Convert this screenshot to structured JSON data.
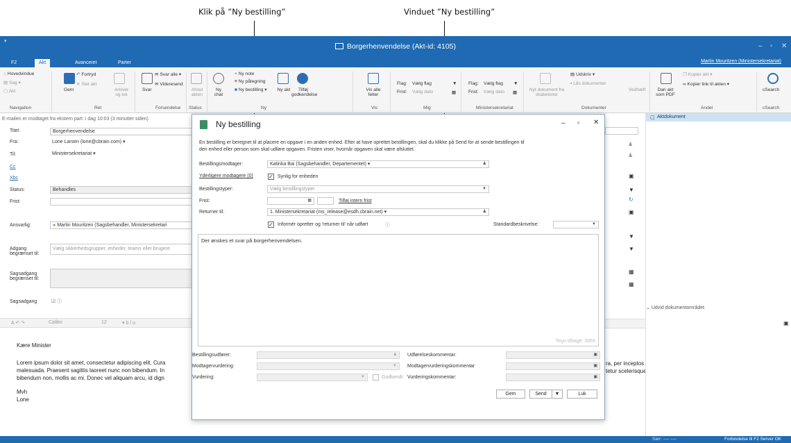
{
  "callouts": {
    "left": "Klik på ”Ny bestilling”",
    "right": "Vinduet ”Ny bestilling”"
  },
  "window": {
    "title": "Borgerhenvendelse (Akt-id: 4105)"
  },
  "tabs": [
    "F2",
    "Akt",
    "Avanceret",
    "Parter"
  ],
  "user": "Martin Mouritzen (Ministersekretariat)",
  "ribbon": {
    "navigation": {
      "items": [
        "Hovedvindue",
        "Sag",
        "Akt"
      ],
      "group": "Navigation"
    },
    "ret": {
      "gem": "Gem",
      "fortryd": "Fortryd",
      "slet": "Slet akt",
      "arkiver": "Arkiver og luk",
      "group": "Ret"
    },
    "forsendelse": {
      "svar": "Svar",
      "svar_alle": "Svar alle",
      "videresend": "Videresend",
      "group": "Forsendelse"
    },
    "status": {
      "afslut": "Afslut akten",
      "group": "Status"
    },
    "ny": {
      "ny_chat": "Ny chat",
      "ny_note": "Ny note",
      "ny_paategning": "Ny påtegning",
      "ny_bestilling": "Ny bestilling",
      "ny_akt": "Ny akt",
      "tilfoej_godkendelse": "Tilføj godkendelse",
      "group": "Ny"
    },
    "vis": {
      "vis_alle": "Vis alle felter",
      "group": "Vis"
    },
    "mig": {
      "flag": "Flag:",
      "flag_val": "Vælg flag",
      "frist": "Frist:",
      "frist_val": "Vælg dato",
      "group": "Mig"
    },
    "minister": {
      "flag": "Flag:",
      "flag_val": "Vælg flag",
      "frist": "Frist:",
      "frist_val": "Vælg dato",
      "group": "Ministersekretariat"
    },
    "dokumenter": {
      "nyt": "Nyt dokument fra skabeloner",
      "udskriv": "Udskriv",
      "laas": "Lås dokumenter",
      "vedhaeft": "Vedhæft",
      "group": "Dokumenter"
    },
    "andet": {
      "dan_pdf": "Dan akt som PDF",
      "kopier_akt": "Kopier akt",
      "kopier_link": "Kopier link til akten",
      "group": "Andet"
    },
    "csearch": {
      "label": "cSearch",
      "group": "cSearch"
    }
  },
  "form": {
    "info": "E-mailen er modtaget fra ekstern part:  i dag 10:03 (3 minutter siden)",
    "titel_label": "Titel:",
    "titel": "Borgerhenvendelse",
    "fra_label": "Fra:",
    "fra": "Lone Larsen (lone@cbrain.com)",
    "til_label": "Til:",
    "til": "Ministersekretariat",
    "cc_label": "Cc",
    "xbc_label": "Xbc",
    "status_label": "Status:",
    "status": "Behandles",
    "frist_label": "Frist:",
    "ansvarlig_label": "Ansvarlig:",
    "ansvarlig": "Martin Mouritzen (Sagsbehandler, Ministersekretari",
    "adgang_label": "Adgang begrænset til:",
    "adgang_placeholder": "Vælg sikkerhedsgrupper, enheder, teams eller brugere",
    "sagsadgang_begr_label": "Sagsadgang begrænset til:",
    "sagsadgang_label": "Sagsadgang",
    "font": "Calibri",
    "size": "12"
  },
  "email": {
    "greeting": "Kære Minister",
    "l1": "Lorem ipsum dolor sit amet, consectetur adipiscing elit. Cura",
    "l2": "malesuada. Praesent sagittis laoreet nunc non bibendum. In",
    "l3": "bibendum non, mollis ac mi. Donec vel aliquam arcu, id dign",
    "r1": "ra, per inceptos himenaeos. Nam rutrum ligula vel consequat",
    "r2": "tetur scelerisque ultrices. Nullam tortor felis, pretium nec",
    "sign1": "Mvh",
    "sign2": "Lone"
  },
  "right": {
    "aktdokument": "Aktdokument",
    "udvid": "Udvid dokumentområdet"
  },
  "dialog": {
    "title": "Ny bestilling",
    "intro1": "En bestilling er beregnet til at placere en opgave i en anden enhed. Efter at have oprettet bestillingen, skal du klikke på Send for at sende bestillingen til",
    "intro2": "den enhed eller person som skal udføre opgaven. Fristen viser, hvornår opgaven skal være afsluttet.",
    "modtager_label": "Bestillingsmodtager:",
    "modtager": "Katinka Bai (Sagsbehandler, Departementet)",
    "yderligere": "Yderligere modtagere (0)",
    "synlig": "Synlig for enheden",
    "typer_label": "Bestillingstyper:",
    "typer_placeholder": "Vælg bestillingstyper",
    "frist_label": "Frist:",
    "tilfoej_frist": "Tilføj intern frist",
    "returner_label": "Returner til:",
    "returner": "1. Ministersekretariat (ms_release@esdh.cbrain.net)",
    "informer": "Informér opretter og 'returner til' når udført",
    "standard_label": "Standardbeskrivelse:",
    "body": "Der ønskes et svar på borgerhenvendelsen.",
    "tegn": "Tegn tilbage: 3959",
    "udfoerer_label": "Bestillingsudfører:",
    "modtagervurdering_label": "Modtagervurdering:",
    "vurdering_label": "Vurdering:",
    "godkendt": "Godkendt",
    "udfoerelseskommentar_label": "Udførelseskommentar:",
    "modtagervurderingskommentar_label": "Modtagervurderingskommentar",
    "vurderingskommentar_label": "Vurderingskommentar:",
    "gem": "Gem",
    "send": "Send",
    "luk": "Luk"
  },
  "statusbar": {
    "sarr": "Sarr: ---- ----",
    "forbindelse": "Forbindelse til F2 Server OK"
  }
}
